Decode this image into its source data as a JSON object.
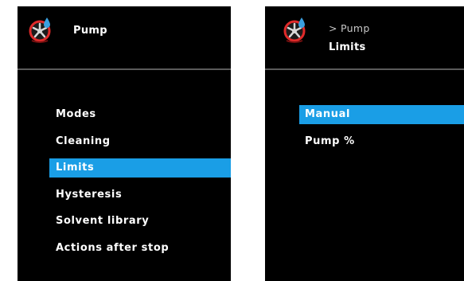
{
  "left_screen": {
    "title": "Pump",
    "icon": "pump-icon",
    "menu": [
      {
        "label": "Modes",
        "selected": false
      },
      {
        "label": "Cleaning",
        "selected": false
      },
      {
        "label": "Limits",
        "selected": true
      },
      {
        "label": "Hysteresis",
        "selected": false
      },
      {
        "label": "Solvent library",
        "selected": false
      },
      {
        "label": "Actions after stop",
        "selected": false
      }
    ]
  },
  "right_screen": {
    "breadcrumb": "> Pump",
    "title": "Limits",
    "icon": "pump-icon",
    "menu": [
      {
        "label": "Manual",
        "selected": true
      },
      {
        "label": "Pump %",
        "selected": false
      }
    ]
  },
  "colors": {
    "screen_background": "#000000",
    "highlight": "#1a9ee6",
    "text": "#ffffff",
    "divider": "#5a5a5a",
    "icon_red": "#e02a2a",
    "icon_blue": "#3aa0e0"
  }
}
